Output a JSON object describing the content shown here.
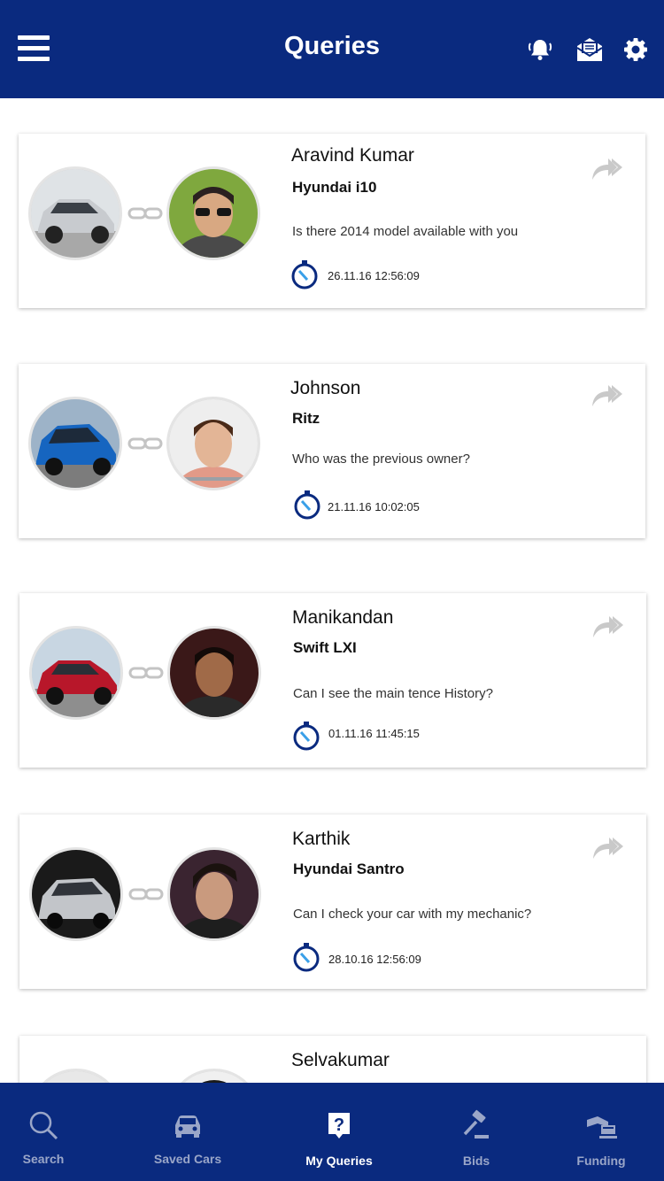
{
  "header": {
    "title": "Queries"
  },
  "queries": [
    {
      "name": "Aravind Kumar",
      "car": "Hyundai i10",
      "message": "Is there 2014 model available with you",
      "time": "26.11.16 12:56:09"
    },
    {
      "name": "Johnson",
      "car": "Ritz",
      "message": "Who was the previous owner?",
      "time": "21.11.16 10:02:05"
    },
    {
      "name": "Manikandan",
      "car": "Swift LXI",
      "message": "Can I see the main tence History?",
      "time": "01.11.16 11:45:15"
    },
    {
      "name": "Karthik",
      "car": "Hyundai Santro",
      "message": "Can I check your car with my mechanic?",
      "time": "28.10.16 12:56:09"
    },
    {
      "name": "Selvakumar"
    }
  ],
  "nav": [
    {
      "label": "Search",
      "icon": "search-icon"
    },
    {
      "label": "Saved Cars",
      "icon": "car-icon"
    },
    {
      "label": "My Queries",
      "icon": "question-icon"
    },
    {
      "label": "Bids",
      "icon": "gavel-icon"
    },
    {
      "label": "Funding",
      "icon": "funding-icon"
    }
  ],
  "nav_active": "My Queries",
  "colors": {
    "primary": "#0a2a7f",
    "inactive_tab": "#9aa6c8"
  }
}
